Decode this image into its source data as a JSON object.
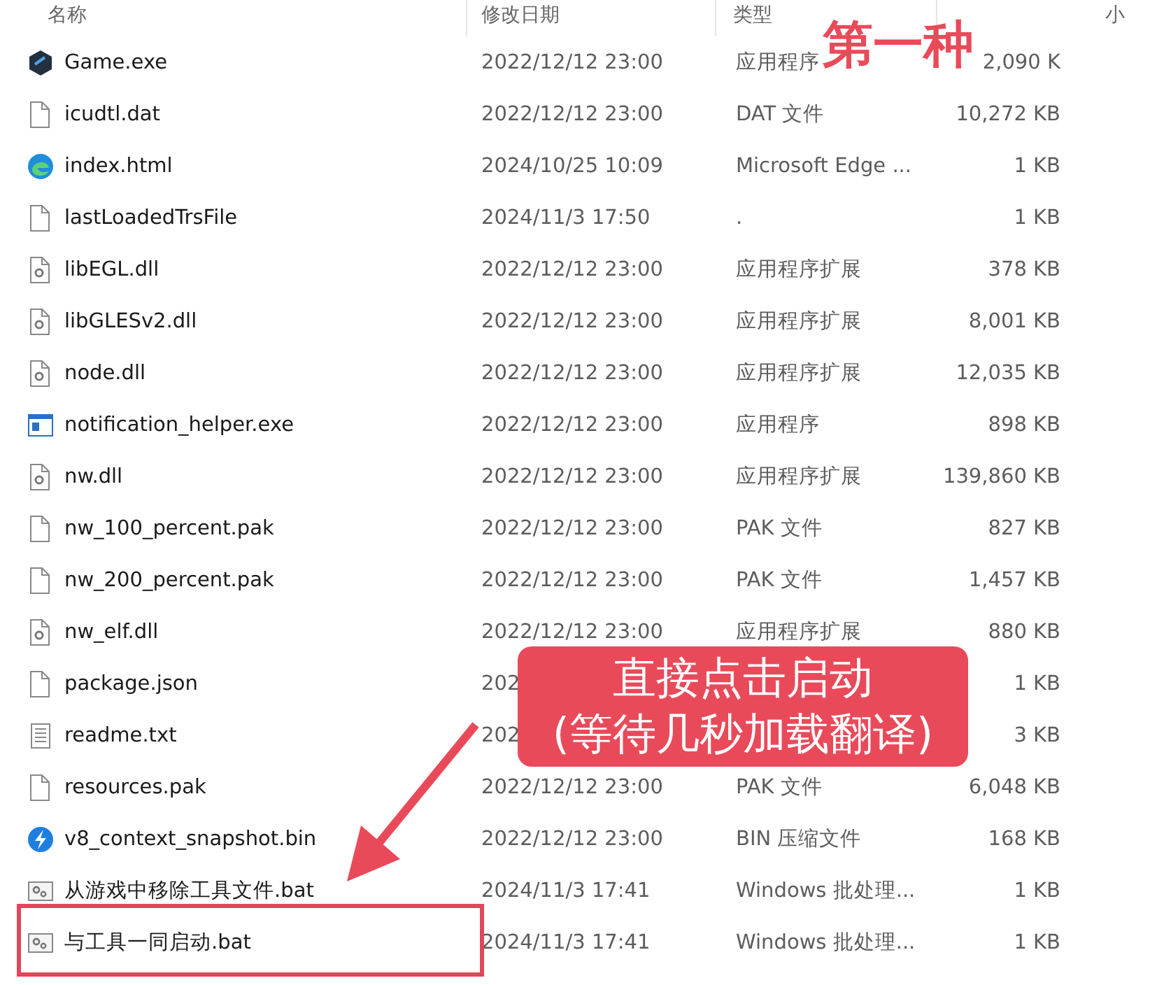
{
  "columns": [
    {
      "label": "名称"
    },
    {
      "label": "修改日期"
    },
    {
      "label": "类型"
    },
    {
      "label": "小"
    }
  ],
  "files": [
    {
      "kind": "app",
      "name": "Game.exe",
      "date": "2022/12/12 23:00",
      "type": "应用程序",
      "size": "2,090 K"
    },
    {
      "kind": "file",
      "name": "icudtl.dat",
      "date": "2022/12/12 23:00",
      "type": "DAT 文件",
      "size": "10,272 KB"
    },
    {
      "kind": "web",
      "name": "index.html",
      "date": "2024/10/25 10:09",
      "type": "Microsoft Edge ...",
      "size": "1 KB"
    },
    {
      "kind": "file",
      "name": "lastLoadedTrsFile",
      "date": "2024/11/3 17:50",
      "type": ".",
      "size": "1 KB"
    },
    {
      "kind": "extension",
      "name": "libEGL.dll",
      "date": "2022/12/12 23:00",
      "type": "应用程序扩展",
      "size": "378 KB"
    },
    {
      "kind": "extension",
      "name": "libGLESv2.dll",
      "date": "2022/12/12 23:00",
      "type": "应用程序扩展",
      "size": "8,001 KB"
    },
    {
      "kind": "extension",
      "name": "node.dll",
      "date": "2022/12/12 23:00",
      "type": "应用程序扩展",
      "size": "12,035 KB"
    },
    {
      "kind": "program",
      "name": "notification_helper.exe",
      "date": "2022/12/12 23:00",
      "type": "应用程序",
      "size": "898 KB"
    },
    {
      "kind": "extension",
      "name": "nw.dll",
      "date": "2022/12/12 23:00",
      "type": "应用程序扩展",
      "size": "139,860 KB"
    },
    {
      "kind": "file",
      "name": "nw_100_percent.pak",
      "date": "2022/12/12 23:00",
      "type": "PAK 文件",
      "size": "827 KB"
    },
    {
      "kind": "file",
      "name": "nw_200_percent.pak",
      "date": "2022/12/12 23:00",
      "type": "PAK 文件",
      "size": "1,457 KB"
    },
    {
      "kind": "extension",
      "name": "nw_elf.dll",
      "date": "2022/12/12 23:00",
      "type": "应用程序扩展",
      "size": "880 KB"
    },
    {
      "kind": "file",
      "name": "package.json",
      "date": "202",
      "size": "1 KB"
    },
    {
      "kind": "text",
      "name": "readme.txt",
      "date": "202",
      "size": "3 KB"
    },
    {
      "kind": "file",
      "name": "resources.pak",
      "date": "2022/12/12 23:00",
      "type": "PAK 文件",
      "size": "6,048 KB"
    },
    {
      "kind": "archive",
      "name": "v8_context_snapshot.bin",
      "date": "2022/12/12 23:00",
      "type": "BIN 压缩文件",
      "size": "168 KB"
    },
    {
      "kind": "batch",
      "name": "从游戏中移除工具文件.bat",
      "date": "2024/11/3 17:41",
      "type": "Windows 批处理...",
      "size": "1 KB"
    },
    {
      "kind": "batch",
      "name": "与工具一同启动.bat",
      "date": "2024/11/3 17:41",
      "type": "Windows 批处理...",
      "size": "1 KB",
      "highlighted": true
    }
  ],
  "annotations": {
    "title": "第一种",
    "callout": [
      "直接点击启动",
      "(等待几秒加载翻译)"
    ]
  }
}
